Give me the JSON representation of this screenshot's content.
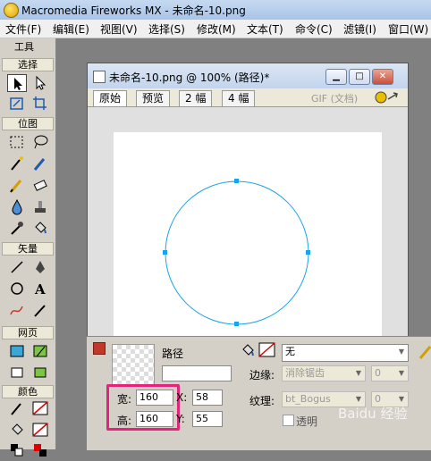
{
  "window": {
    "title": "Macromedia Fireworks MX - 未命名-10.png"
  },
  "menu": [
    "文件(F)",
    "编辑(E)",
    "视图(V)",
    "选择(S)",
    "修改(M)",
    "文本(T)",
    "命令(C)",
    "滤镜(I)",
    "窗口(W)"
  ],
  "tools": {
    "title": "工具",
    "sections": {
      "select": "选择",
      "bitmap": "位图",
      "vector": "矢量",
      "web": "网页",
      "colors": "颜色"
    }
  },
  "document": {
    "title": "未命名-10.png @  100% (路径)*",
    "tabs": [
      "原始",
      "预览",
      "2 幅",
      "4 幅"
    ],
    "format_label": "GIF (文档)"
  },
  "shape": {
    "type": "circle",
    "stroke": "#1aa3e8"
  },
  "properties": {
    "object_type": "路径",
    "name_value": "",
    "width_label": "宽:",
    "width_value": "160",
    "height_label": "高:",
    "height_value": "160",
    "x_label": "X:",
    "x_value": "58",
    "y_label": "Y:",
    "y_value": "55",
    "fill_value": "无",
    "edge_label": "边缘:",
    "edge_value": "消除锯齿",
    "edge_amount": "0",
    "texture_label": "纹理:",
    "texture_value": "bt_Bogus",
    "texture_amount": "0",
    "transparent_label": "透明"
  },
  "colors": {
    "highlight": "#e4237c",
    "accent": "#1aa3e8"
  },
  "watermark": "Baidu 经验"
}
